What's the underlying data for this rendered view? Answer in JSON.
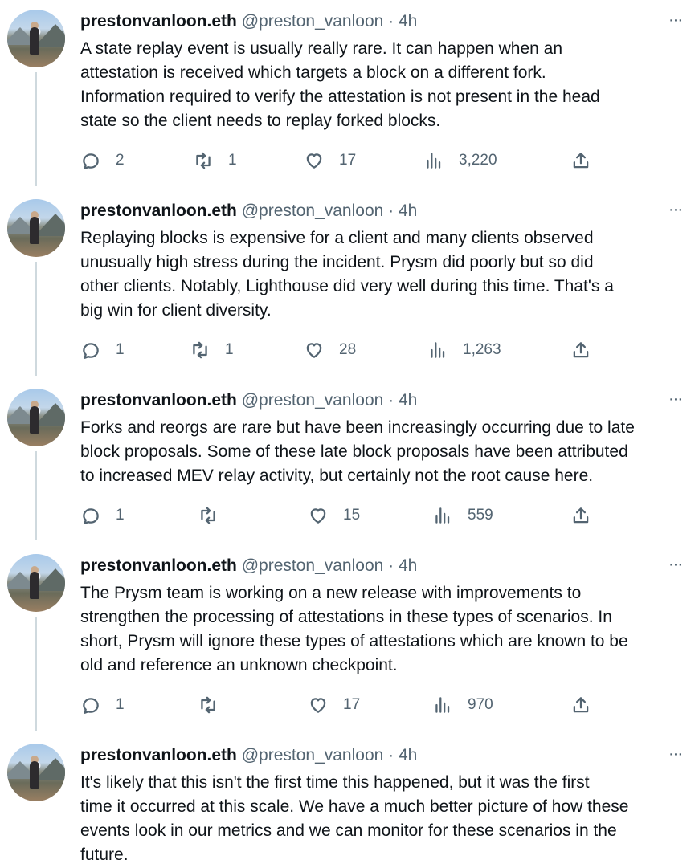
{
  "tweets": [
    {
      "name": "prestonvanloon.eth",
      "handle": "@preston_vanloon",
      "time": "· 4h",
      "more": "···",
      "text": "A state replay event is usually really rare. It can happen when an\nattestation is received which targets a block on a different fork.\nInformation required to verify the attestation is not present in the head\nstate so the client needs to replay forked blocks.",
      "replies": "2",
      "retweets": "1",
      "likes": "17",
      "views": "3,220"
    },
    {
      "name": "prestonvanloon.eth",
      "handle": "@preston_vanloon",
      "time": "· 4h",
      "more": "···",
      "text": "Replaying blocks is expensive for a client and many clients observed\nunusually high stress during the incident. Prysm did poorly but so did\nother clients. Notably, Lighthouse did very well during this time. That's a\nbig win for client diversity.",
      "replies": "1",
      "retweets": "1",
      "likes": "28",
      "views": "1,263"
    },
    {
      "name": "prestonvanloon.eth",
      "handle": "@preston_vanloon",
      "time": "· 4h",
      "more": "···",
      "text": "Forks and reorgs are rare but have been increasingly occurring due to late\nblock proposals. Some of these late block proposals have been attributed\nto increased MEV relay activity, but certainly not the root cause here.",
      "replies": "1",
      "retweets": "",
      "likes": "15",
      "views": "559"
    },
    {
      "name": "prestonvanloon.eth",
      "handle": "@preston_vanloon",
      "time": "· 4h",
      "more": "···",
      "text": "The Prysm team is working on a new release with improvements to\nstrengthen the processing of attestations in these types of scenarios. In\nshort, Prysm will ignore these types of attestations which are known to be\nold and reference an unknown checkpoint.",
      "replies": "1",
      "retweets": "",
      "likes": "17",
      "views": "970"
    },
    {
      "name": "prestonvanloon.eth",
      "handle": "@preston_vanloon",
      "time": "· 4h",
      "more": "···",
      "text": "It's likely that this isn't the first time this happened, but it was the first\ntime it occurred at this scale. We have a much better picture of how these\nevents look in our metrics and we can monitor for these scenarios in the\nfuture.",
      "replies": "",
      "retweets": "",
      "likes": "",
      "views": ""
    }
  ],
  "icons": {
    "reply": "reply-icon",
    "retweet": "retweet-icon",
    "like": "heart-icon",
    "views": "views-icon",
    "share": "share-icon"
  },
  "colors": {
    "text": "#0f1419",
    "muted": "#536471",
    "thread_line": "#cfd9de"
  }
}
